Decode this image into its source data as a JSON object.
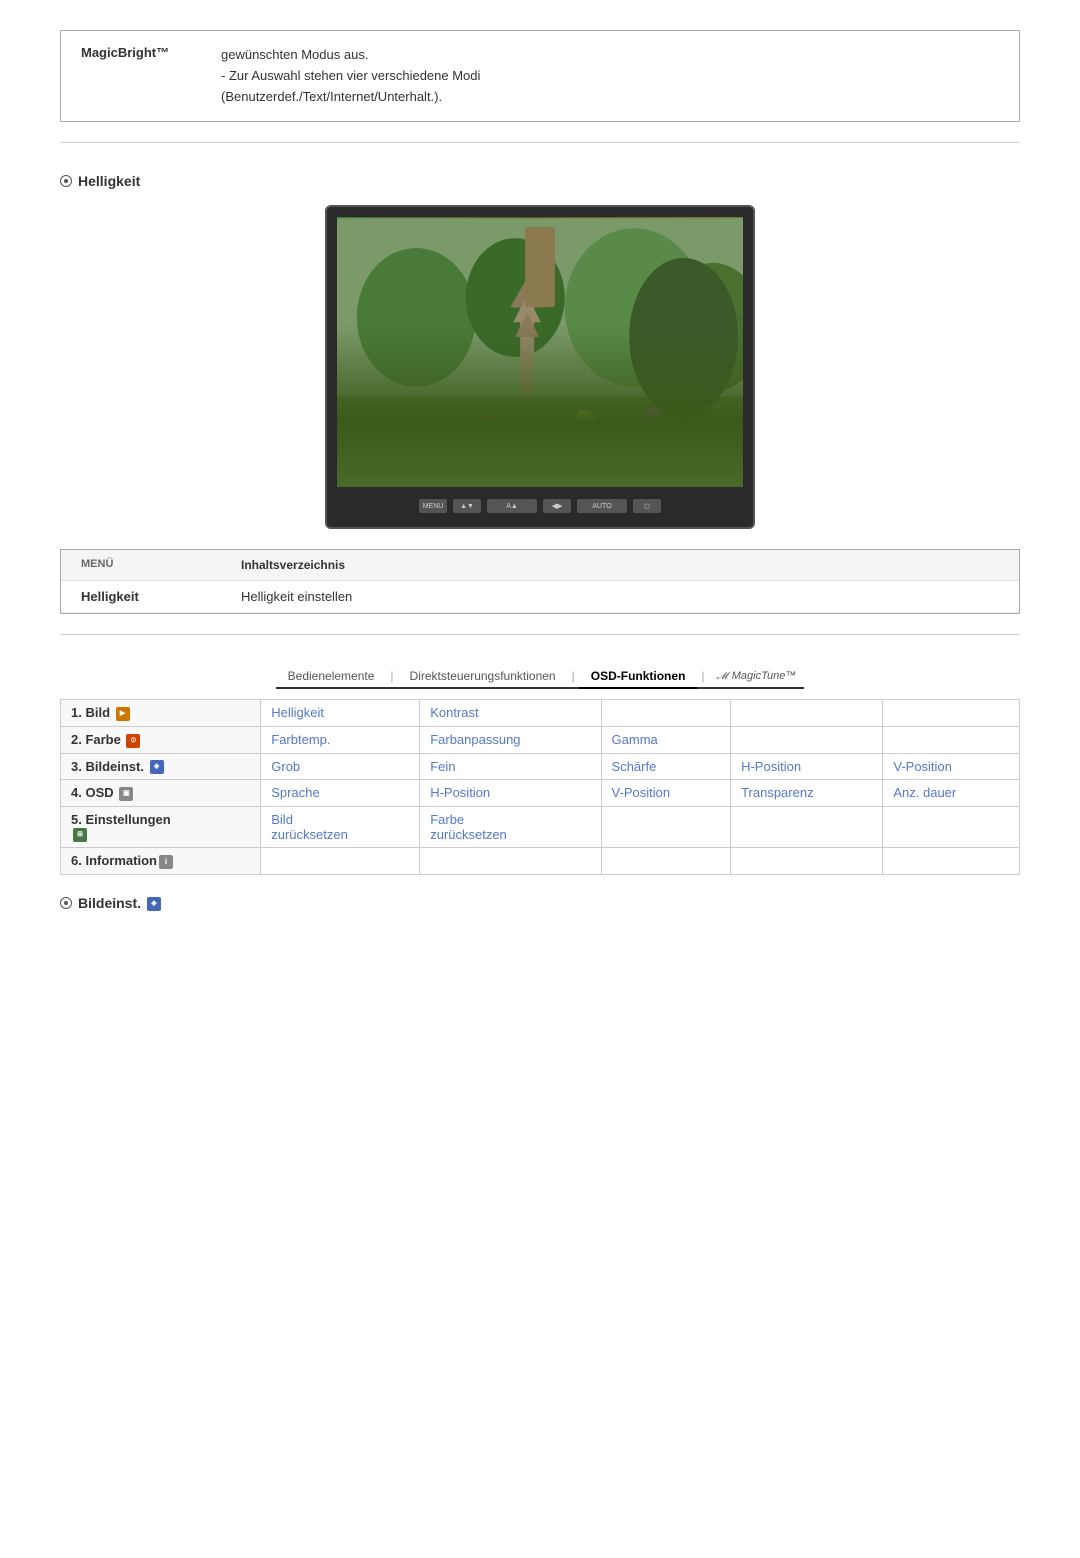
{
  "topBox": {
    "label": "MagicBright™",
    "lines": [
      "gewünschten Modus aus.",
      "- Zur Auswahl stehen vier verschiedene Modi",
      "(Benutzerdef./Text/Internet/Unterhalt.)."
    ]
  },
  "helligkeitSection": {
    "title": "Helligkeit"
  },
  "menuBox": {
    "col1Header": "MENÜ",
    "col2Header": "Inhaltsverzeichnis",
    "rows": [
      {
        "col1": "Helligkeit",
        "col2": "Helligkeit einstellen"
      }
    ]
  },
  "navTabs": {
    "tabs": [
      {
        "label": "Bedienelemente",
        "active": false
      },
      {
        "label": "Direktsteuerungsfunktionen",
        "active": false
      },
      {
        "label": "OSD-Funktionen",
        "active": true
      },
      {
        "label": "MagicTune™",
        "active": false,
        "brand": true
      }
    ]
  },
  "osdTable": {
    "rows": [
      {
        "menuItem": "1. Bild",
        "menuIcon": "img",
        "cells": [
          "Helligkeit",
          "Kontrast",
          "",
          ""
        ]
      },
      {
        "menuItem": "2. Farbe",
        "menuIcon": "farbe",
        "cells": [
          "Farbtemp.",
          "Farbanpassung",
          "Gamma",
          ""
        ]
      },
      {
        "menuItem": "3. Bildeinst.",
        "menuIcon": "bildeinst",
        "cells": [
          "Grob",
          "Fein",
          "Schärfe",
          "H-Position",
          "V-Position"
        ]
      },
      {
        "menuItem": "4. OSD",
        "menuIcon": "osd",
        "cells": [
          "Sprache",
          "H-Position",
          "V-Position",
          "Transparenz",
          "Anz. dauer"
        ]
      },
      {
        "menuItem": "5. Einstellungen",
        "menuIcon": "einst",
        "cells": [
          "Bild zurücksetzen",
          "Farbe zurücksetzen",
          "",
          "",
          ""
        ]
      },
      {
        "menuItem": "6. Information",
        "menuIcon": "info",
        "cells": [
          "",
          "",
          "",
          "",
          ""
        ]
      }
    ]
  },
  "bildeinst": {
    "title": "Bildeinst."
  },
  "monitorButtons": [
    "MENÜ",
    "▲▼",
    "A▲",
    "◀▶",
    "AUTO",
    "◻"
  ]
}
